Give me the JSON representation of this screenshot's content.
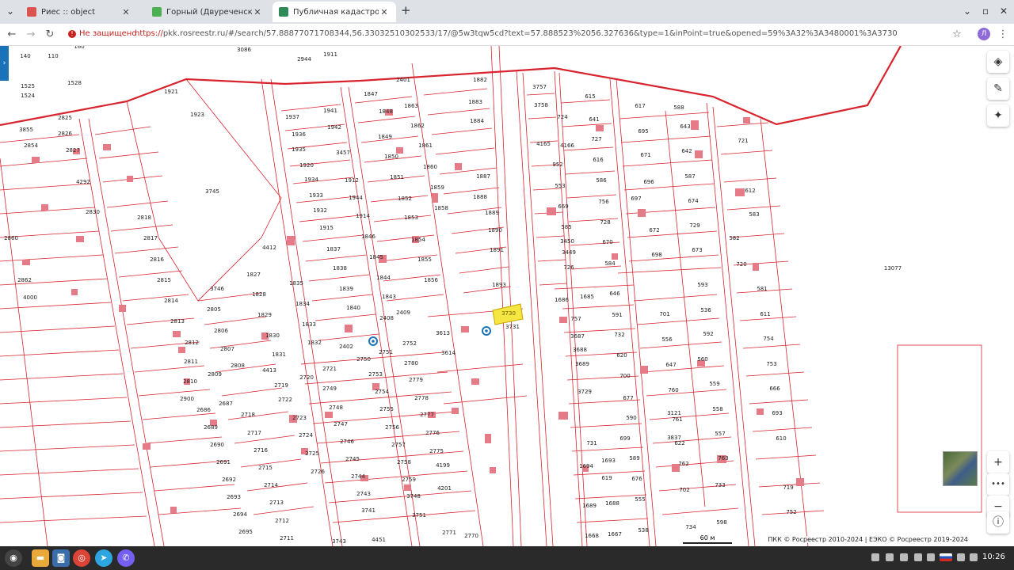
{
  "tabs": [
    {
      "title": "Риес :: object",
      "favcolor": "#d9534f"
    },
    {
      "title": "Горный (Двуреченский сп)",
      "favcolor": "#4caf50"
    },
    {
      "title": "Публичная кадастровая ка",
      "favcolor": "#2e8b57"
    }
  ],
  "toolbar": {
    "not_secure": "Не защищено",
    "url_scheme": "https://",
    "url_rest": "pkk.rosreestr.ru/#/search/57.88877071708344,56.33032510302533/17/@5w3tqw5cd?text=57.888523%2056.327636&type=1&inPoint=true&opened=59%3A32%3A3480001%3A3730",
    "avatar_letter": "Л"
  },
  "map": {
    "highlight_label": "3730",
    "big_plot_label": "13077",
    "scale_label": "60 м",
    "attribution": "ПКК © Росреестр 2010-2024 | ЕЭКО © Росреестр 2019-2024",
    "labels": [
      [
        "140",
        32,
        73
      ],
      [
        "110",
        67,
        73
      ],
      [
        "160",
        100,
        61
      ],
      [
        "1525",
        35,
        111
      ],
      [
        "1524",
        35,
        123
      ],
      [
        "1528",
        94,
        107
      ],
      [
        "2944",
        384,
        77
      ],
      [
        "1911",
        417,
        71
      ],
      [
        "3086",
        308,
        65
      ],
      [
        "2401",
        509,
        103
      ],
      [
        "1882",
        606,
        103
      ],
      [
        "3757",
        681,
        112
      ],
      [
        "615",
        745,
        124
      ],
      [
        "617",
        808,
        136
      ],
      [
        "588",
        857,
        138
      ],
      [
        "721",
        938,
        180
      ],
      [
        "2825",
        82,
        151
      ],
      [
        "2826",
        82,
        171
      ],
      [
        "3855",
        33,
        166
      ],
      [
        "2854",
        39,
        186
      ],
      [
        "2827",
        92,
        192
      ],
      [
        "1921",
        216,
        118
      ],
      [
        "1923",
        249,
        147
      ],
      [
        "1937",
        369,
        150
      ],
      [
        "1941",
        417,
        142
      ],
      [
        "1942",
        422,
        163
      ],
      [
        "1847",
        468,
        121
      ],
      [
        "1848",
        487,
        143
      ],
      [
        "1863",
        519,
        136
      ],
      [
        "1883",
        600,
        131
      ],
      [
        "1884",
        602,
        155
      ],
      [
        "1849",
        486,
        175
      ],
      [
        "1862",
        527,
        161
      ],
      [
        "1861",
        537,
        186
      ],
      [
        "1936",
        377,
        172
      ],
      [
        "1935",
        377,
        191
      ],
      [
        "3457",
        433,
        195
      ],
      [
        "1850",
        494,
        200
      ],
      [
        "1860",
        543,
        213
      ],
      [
        "3758",
        683,
        135
      ],
      [
        "724",
        710,
        150
      ],
      [
        "641",
        750,
        153
      ],
      [
        "695",
        812,
        168
      ],
      [
        "643",
        865,
        162
      ],
      [
        "642",
        867,
        193
      ],
      [
        "727",
        753,
        178
      ],
      [
        "4165",
        686,
        184
      ],
      [
        "4166",
        716,
        186
      ],
      [
        "616",
        755,
        204
      ],
      [
        "671",
        815,
        198
      ],
      [
        "952",
        704,
        210
      ],
      [
        "553",
        707,
        237
      ],
      [
        "586",
        759,
        230
      ],
      [
        "696",
        819,
        232
      ],
      [
        "587",
        871,
        225
      ],
      [
        "612",
        947,
        243
      ],
      [
        "583",
        952,
        273
      ],
      [
        "4292",
        105,
        232
      ],
      [
        "3745",
        268,
        244
      ],
      [
        "1920",
        387,
        211
      ],
      [
        "1934",
        393,
        229
      ],
      [
        "1933",
        399,
        249
      ],
      [
        "1912",
        444,
        230
      ],
      [
        "1944",
        449,
        252
      ],
      [
        "1851",
        501,
        226
      ],
      [
        "1852",
        511,
        253
      ],
      [
        "1859",
        552,
        239
      ],
      [
        "1887",
        610,
        225
      ],
      [
        "1888",
        606,
        251
      ],
      [
        "2830",
        117,
        270
      ],
      [
        "2818",
        182,
        277
      ],
      [
        "1932",
        404,
        268
      ],
      [
        "1914",
        458,
        275
      ],
      [
        "1853",
        519,
        277
      ],
      [
        "1858",
        557,
        265
      ],
      [
        "1889",
        621,
        271
      ],
      [
        "669",
        711,
        263
      ],
      [
        "756",
        762,
        257
      ],
      [
        "697",
        803,
        253
      ],
      [
        "674",
        875,
        256
      ],
      [
        "585",
        715,
        289
      ],
      [
        "728",
        764,
        283
      ],
      [
        "672",
        826,
        293
      ],
      [
        "729",
        877,
        287
      ],
      [
        "582",
        927,
        303
      ],
      [
        "2860",
        14,
        303
      ],
      [
        "2817",
        190,
        303
      ],
      [
        "1915",
        412,
        290
      ],
      [
        "1846",
        465,
        301
      ],
      [
        "1854",
        528,
        305
      ],
      [
        "1890",
        625,
        293
      ],
      [
        "3450",
        716,
        307
      ],
      [
        "3449",
        718,
        321
      ],
      [
        "670",
        767,
        308
      ],
      [
        "698",
        829,
        324
      ],
      [
        "673",
        880,
        318
      ],
      [
        "720",
        936,
        336
      ],
      [
        "2816",
        198,
        330
      ],
      [
        "4412",
        340,
        315
      ],
      [
        "1837",
        421,
        317
      ],
      [
        "1855",
        536,
        330
      ],
      [
        "1891",
        627,
        318
      ],
      [
        "726",
        718,
        340
      ],
      [
        "584",
        770,
        335
      ],
      [
        "2862",
        31,
        356
      ],
      [
        "2815",
        207,
        356
      ],
      [
        "1827",
        320,
        349
      ],
      [
        "1835",
        374,
        360
      ],
      [
        "1838",
        429,
        341
      ],
      [
        "1845",
        475,
        327
      ],
      [
        "1844",
        484,
        353
      ],
      [
        "1856",
        544,
        356
      ],
      [
        "1893",
        630,
        362
      ],
      [
        "581",
        962,
        367
      ],
      [
        "593",
        887,
        362
      ],
      [
        "4000",
        38,
        378
      ],
      [
        "2814",
        216,
        382
      ],
      [
        "3746",
        274,
        367
      ],
      [
        "1828",
        327,
        374
      ],
      [
        "1834",
        382,
        386
      ],
      [
        "1839",
        437,
        367
      ],
      [
        "1843",
        491,
        377
      ],
      [
        "1686",
        709,
        381
      ],
      [
        "1685",
        741,
        377
      ],
      [
        "646",
        776,
        373
      ],
      [
        "536",
        891,
        394
      ],
      [
        "611",
        966,
        399
      ],
      [
        "2813",
        224,
        408
      ],
      [
        "2805",
        270,
        393
      ],
      [
        "1829",
        334,
        400
      ],
      [
        "1840",
        446,
        391
      ],
      [
        "2409",
        509,
        397
      ],
      [
        "757",
        727,
        405
      ],
      [
        "591",
        779,
        400
      ],
      [
        "701",
        839,
        399
      ],
      [
        "2806",
        279,
        420
      ],
      [
        "1833",
        390,
        412
      ],
      [
        "2408",
        488,
        404
      ],
      [
        "3731",
        647,
        415
      ],
      [
        "3613",
        559,
        423
      ],
      [
        "3687",
        729,
        427
      ],
      [
        "732",
        782,
        425
      ],
      [
        "556",
        842,
        431
      ],
      [
        "592",
        894,
        424
      ],
      [
        "754",
        970,
        430
      ],
      [
        "2812",
        242,
        435
      ],
      [
        "1830",
        344,
        426
      ],
      [
        "1832",
        397,
        435
      ],
      [
        "1831",
        352,
        450
      ],
      [
        "2402",
        437,
        440
      ],
      [
        "2751",
        487,
        447
      ],
      [
        "2752",
        517,
        436
      ],
      [
        "3614",
        566,
        448
      ],
      [
        "3688",
        732,
        444
      ],
      [
        "620",
        785,
        451
      ],
      [
        "2807",
        287,
        443
      ],
      [
        "2811",
        241,
        459
      ],
      [
        "2750",
        459,
        456
      ],
      [
        "2780",
        519,
        461
      ],
      [
        "3689",
        735,
        462
      ],
      [
        "647",
        847,
        463
      ],
      [
        "560",
        887,
        456
      ],
      [
        "753",
        974,
        462
      ],
      [
        "2808",
        300,
        464
      ],
      [
        "2809",
        271,
        475
      ],
      [
        "4413",
        340,
        470
      ],
      [
        "2721",
        416,
        468
      ],
      [
        "2753",
        474,
        475
      ],
      [
        "2779",
        525,
        482
      ],
      [
        "2778",
        532,
        505
      ],
      [
        "700",
        789,
        477
      ],
      [
        "2810",
        240,
        484
      ],
      [
        "2719",
        355,
        489
      ],
      [
        "2720",
        387,
        479
      ],
      [
        "2749",
        416,
        493
      ],
      [
        "2754",
        482,
        497
      ],
      [
        "3729",
        738,
        497
      ],
      [
        "677",
        793,
        505
      ],
      [
        "760",
        850,
        495
      ],
      [
        "559",
        902,
        487
      ],
      [
        "666",
        978,
        493
      ],
      [
        "2900",
        236,
        506
      ],
      [
        "2686",
        257,
        520
      ],
      [
        "2687",
        285,
        512
      ],
      [
        "2718",
        313,
        526
      ],
      [
        "2722",
        360,
        507
      ],
      [
        "2748",
        424,
        517
      ],
      [
        "2755",
        488,
        519
      ],
      [
        "2777",
        539,
        526
      ],
      [
        "590",
        797,
        530
      ],
      [
        "558",
        906,
        519
      ],
      [
        "2723",
        378,
        530
      ],
      [
        "2747",
        430,
        538
      ],
      [
        "2756",
        495,
        542
      ],
      [
        "2776",
        546,
        549
      ],
      [
        "3121",
        851,
        524
      ],
      [
        "761",
        855,
        532
      ],
      [
        "693",
        981,
        524
      ],
      [
        "2689",
        266,
        542
      ],
      [
        "2717",
        321,
        549
      ],
      [
        "2724",
        386,
        552
      ],
      [
        "2746",
        438,
        560
      ],
      [
        "2757",
        503,
        564
      ],
      [
        "731",
        747,
        562
      ],
      [
        "699",
        789,
        556
      ],
      [
        "3837",
        851,
        555
      ],
      [
        "622",
        858,
        562
      ],
      [
        "557",
        909,
        550
      ],
      [
        "610",
        986,
        556
      ],
      [
        "2690",
        274,
        564
      ],
      [
        "2716",
        329,
        571
      ],
      [
        "2725",
        394,
        575
      ],
      [
        "2745",
        445,
        582
      ],
      [
        "2758",
        510,
        586
      ],
      [
        "2775",
        551,
        572
      ],
      [
        "1693",
        768,
        584
      ],
      [
        "589",
        801,
        581
      ],
      [
        "762",
        863,
        588
      ],
      [
        "763",
        913,
        581
      ],
      [
        "2691",
        282,
        586
      ],
      [
        "2715",
        335,
        593
      ],
      [
        "2726",
        401,
        598
      ],
      [
        "2744",
        452,
        604
      ],
      [
        "2759",
        516,
        608
      ],
      [
        "4199",
        559,
        590
      ],
      [
        "1694",
        740,
        591
      ],
      [
        "619",
        766,
        606
      ],
      [
        "676",
        804,
        607
      ],
      [
        "702",
        864,
        621
      ],
      [
        "733",
        909,
        615
      ],
      [
        "719",
        995,
        618
      ],
      [
        "2692",
        289,
        608
      ],
      [
        "2714",
        342,
        615
      ],
      [
        "3748",
        522,
        629
      ],
      [
        "4201",
        561,
        619
      ],
      [
        "555",
        808,
        633
      ],
      [
        "2693",
        295,
        630
      ],
      [
        "2713",
        349,
        637
      ],
      [
        "2743",
        459,
        626
      ],
      [
        "3741",
        465,
        647
      ],
      [
        "1689",
        744,
        641
      ],
      [
        "1688",
        773,
        638
      ],
      [
        "752",
        999,
        649
      ],
      [
        "2694",
        303,
        652
      ],
      [
        "2712",
        356,
        660
      ],
      [
        "3751",
        529,
        653
      ],
      [
        "734",
        872,
        668
      ],
      [
        "598",
        911,
        662
      ],
      [
        "1668",
        747,
        679
      ],
      [
        "1667",
        776,
        677
      ],
      [
        "538",
        812,
        672
      ],
      [
        "2695",
        310,
        674
      ],
      [
        "2711",
        362,
        682
      ],
      [
        "3743",
        428,
        686
      ],
      [
        "2771",
        567,
        675
      ],
      [
        "2770",
        595,
        679
      ],
      [
        "4451",
        478,
        684
      ]
    ]
  }
}
